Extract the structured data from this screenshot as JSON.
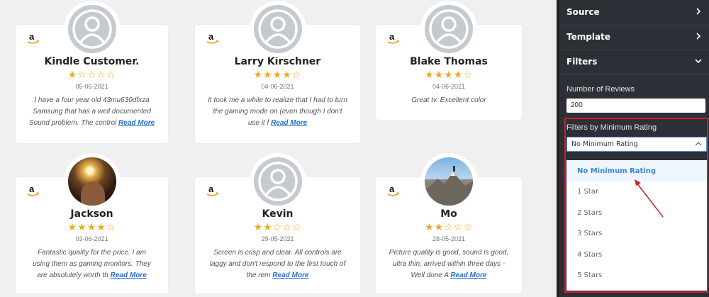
{
  "reviews": [
    {
      "name": "Kindle Customer.",
      "date": "05-06-2021",
      "rating": 1,
      "text": "I have a four year old 43mu630dfxza Samsung that has a well documented Sound problem. The control",
      "read_more": "Read More",
      "avatar": "default"
    },
    {
      "name": "Larry Kirschner",
      "date": "04-06-2021",
      "rating": 4,
      "text": "It took me a while to realize that I had to turn the gaming mode on (even though I don't use it f",
      "read_more": "Read More",
      "avatar": "default"
    },
    {
      "name": "Blake Thomas",
      "date": "04-06-2021",
      "rating": 4,
      "text": "Great tv. Excellent color",
      "read_more": "",
      "avatar": "default"
    },
    {
      "name": "Jackson",
      "date": "03-06-2021",
      "rating": 4,
      "text": "Fantastic quality for the price. I am using them as gaming monitors. They are absolutely worth th",
      "read_more": "Read More",
      "avatar": "photo-person"
    },
    {
      "name": "Kevin",
      "date": "29-05-2021",
      "rating": 2,
      "text": "Screen is crisp and clear. All controls are laggy and don't respond to the first touch of the rem",
      "read_more": "Read More",
      "avatar": "default"
    },
    {
      "name": "Mo",
      "date": "28-05-2021",
      "rating": 2,
      "text": "Picture quality is good, sound is good, ultra thin, arrived within three days - Well done A",
      "read_more": "Read More",
      "avatar": "photo-mountain"
    }
  ],
  "sidebar": {
    "sections": [
      {
        "label": "Source",
        "expanded": false
      },
      {
        "label": "Template",
        "expanded": false
      },
      {
        "label": "Filters",
        "expanded": true
      }
    ],
    "number_of_reviews_label": "Number of Reviews",
    "number_of_reviews_value": "200",
    "min_rating_label": "Filters by Minimum Rating",
    "min_rating_selected": "No Minimum Rating",
    "min_rating_options": [
      "No Minimum Rating",
      "1 Star",
      "2 Stars",
      "3 Stars",
      "4 Stars",
      "5 Stars"
    ]
  },
  "colors": {
    "star": "#f0a91b",
    "accent": "#3a86d8",
    "highlight_box": "#d41c2c",
    "sidebar_bg": "#2c2f35"
  }
}
